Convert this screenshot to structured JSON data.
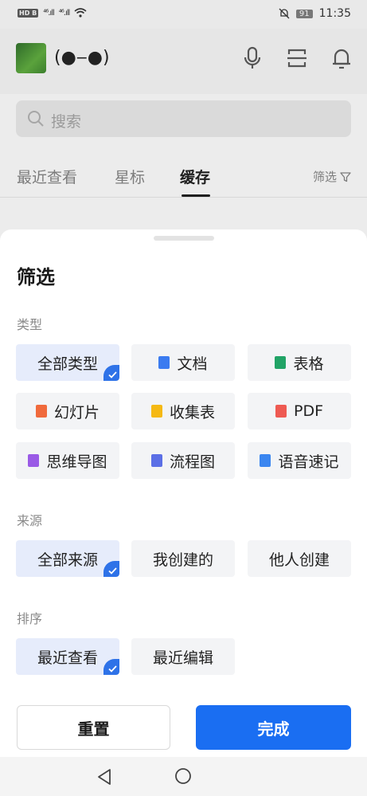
{
  "status_bar": {
    "left_badge": "HD B",
    "signal_1": "⁴⁶.ıll",
    "signal_2": "⁴⁶.ıll",
    "battery": "91",
    "time": "11:35"
  },
  "header": {
    "username": "(●‒●)",
    "icons": [
      "microphone-icon",
      "scan-icon",
      "bell-icon"
    ]
  },
  "search": {
    "placeholder": "搜索"
  },
  "tabs": [
    {
      "label": "最近查看",
      "active": false
    },
    {
      "label": "星标",
      "active": false
    },
    {
      "label": "缓存",
      "active": true
    }
  ],
  "filter_link": {
    "label": "筛选"
  },
  "sheet": {
    "title": "筛选",
    "type_section": {
      "label": "类型",
      "options": [
        {
          "label": "全部类型",
          "icon": "",
          "selected": true
        },
        {
          "label": "文档",
          "icon": "doc-icon",
          "selected": false
        },
        {
          "label": "表格",
          "icon": "sheet-icon",
          "selected": false
        },
        {
          "label": "幻灯片",
          "icon": "slides-icon",
          "selected": false
        },
        {
          "label": "收集表",
          "icon": "form-icon",
          "selected": false
        },
        {
          "label": "PDF",
          "icon": "pdf-icon",
          "selected": false
        },
        {
          "label": "思维导图",
          "icon": "mindmap-icon",
          "selected": false
        },
        {
          "label": "流程图",
          "icon": "flowchart-icon",
          "selected": false
        },
        {
          "label": "语音速记",
          "icon": "voice-note-icon",
          "selected": false
        }
      ]
    },
    "source_section": {
      "label": "来源",
      "options": [
        {
          "label": "全部来源",
          "selected": true
        },
        {
          "label": "我创建的",
          "selected": false
        },
        {
          "label": "他人创建",
          "selected": false
        }
      ]
    },
    "sort_section": {
      "label": "排序",
      "options": [
        {
          "label": "最近查看",
          "selected": true
        },
        {
          "label": "最近编辑",
          "selected": false
        }
      ]
    },
    "reset_label": "重置",
    "done_label": "完成"
  },
  "colors": {
    "accent": "#1a6ef2",
    "selected_bg": "#e6ecfb",
    "option_bg": "#f3f4f6"
  }
}
